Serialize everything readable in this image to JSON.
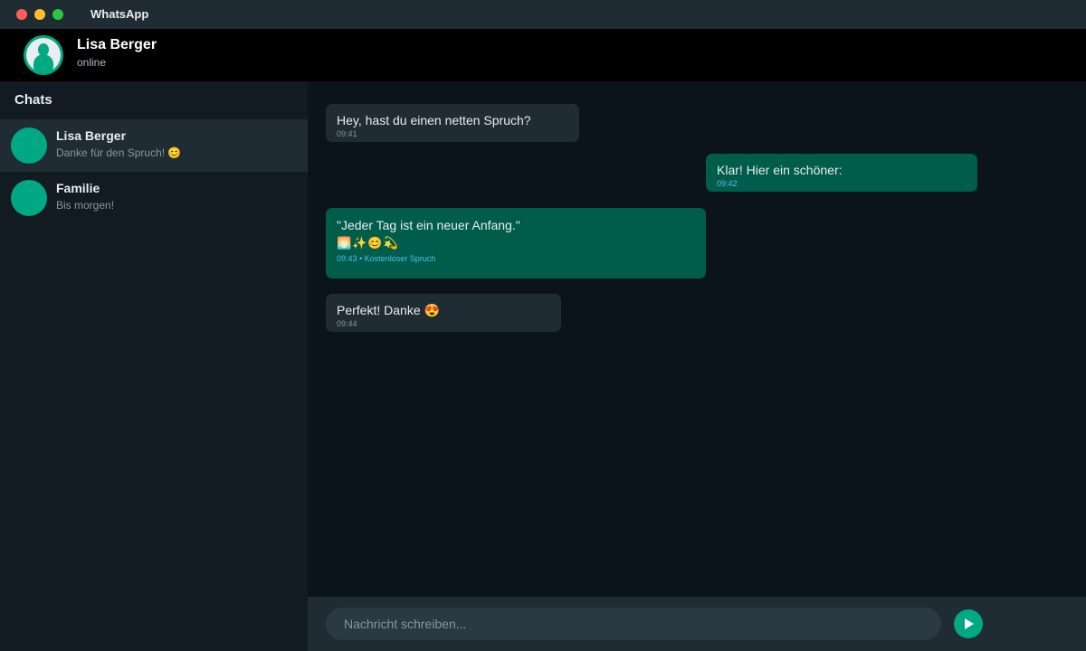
{
  "app": {
    "title": "WhatsApp"
  },
  "header": {
    "contact_name": "Lisa Berger",
    "status": "online"
  },
  "sidebar": {
    "title": "Chats",
    "chats": [
      {
        "name": "Lisa Berger",
        "preview": "Danke für den Spruch! 😊",
        "active": true
      },
      {
        "name": "Familie",
        "preview": "Bis morgen!",
        "active": false
      }
    ]
  },
  "messages": [
    {
      "direction": "incoming",
      "text": "Hey, hast du einen netten Spruch?",
      "time": "09:41"
    },
    {
      "direction": "outgoing",
      "text": "Klar! Hier ein schöner:",
      "time": "09:42"
    },
    {
      "direction": "outgoing",
      "text": "\"Jeder Tag ist ein neuer Anfang.\"",
      "emoji": "🌅✨😊💫",
      "time": "09:43 • Kostenloser Spruch"
    },
    {
      "direction": "incoming",
      "text": "Perfekt! Danke 😍",
      "time": "09:44"
    }
  ],
  "composer": {
    "placeholder": "Nachricht schreiben..."
  },
  "colors": {
    "accent": "#00a884",
    "outgoing_bubble": "#005c4b",
    "incoming_bubble": "#202c33",
    "background": "#0b141a",
    "sidebar": "#111b21"
  },
  "icons": {
    "send": "send-icon",
    "avatar": "avatar-icon"
  }
}
